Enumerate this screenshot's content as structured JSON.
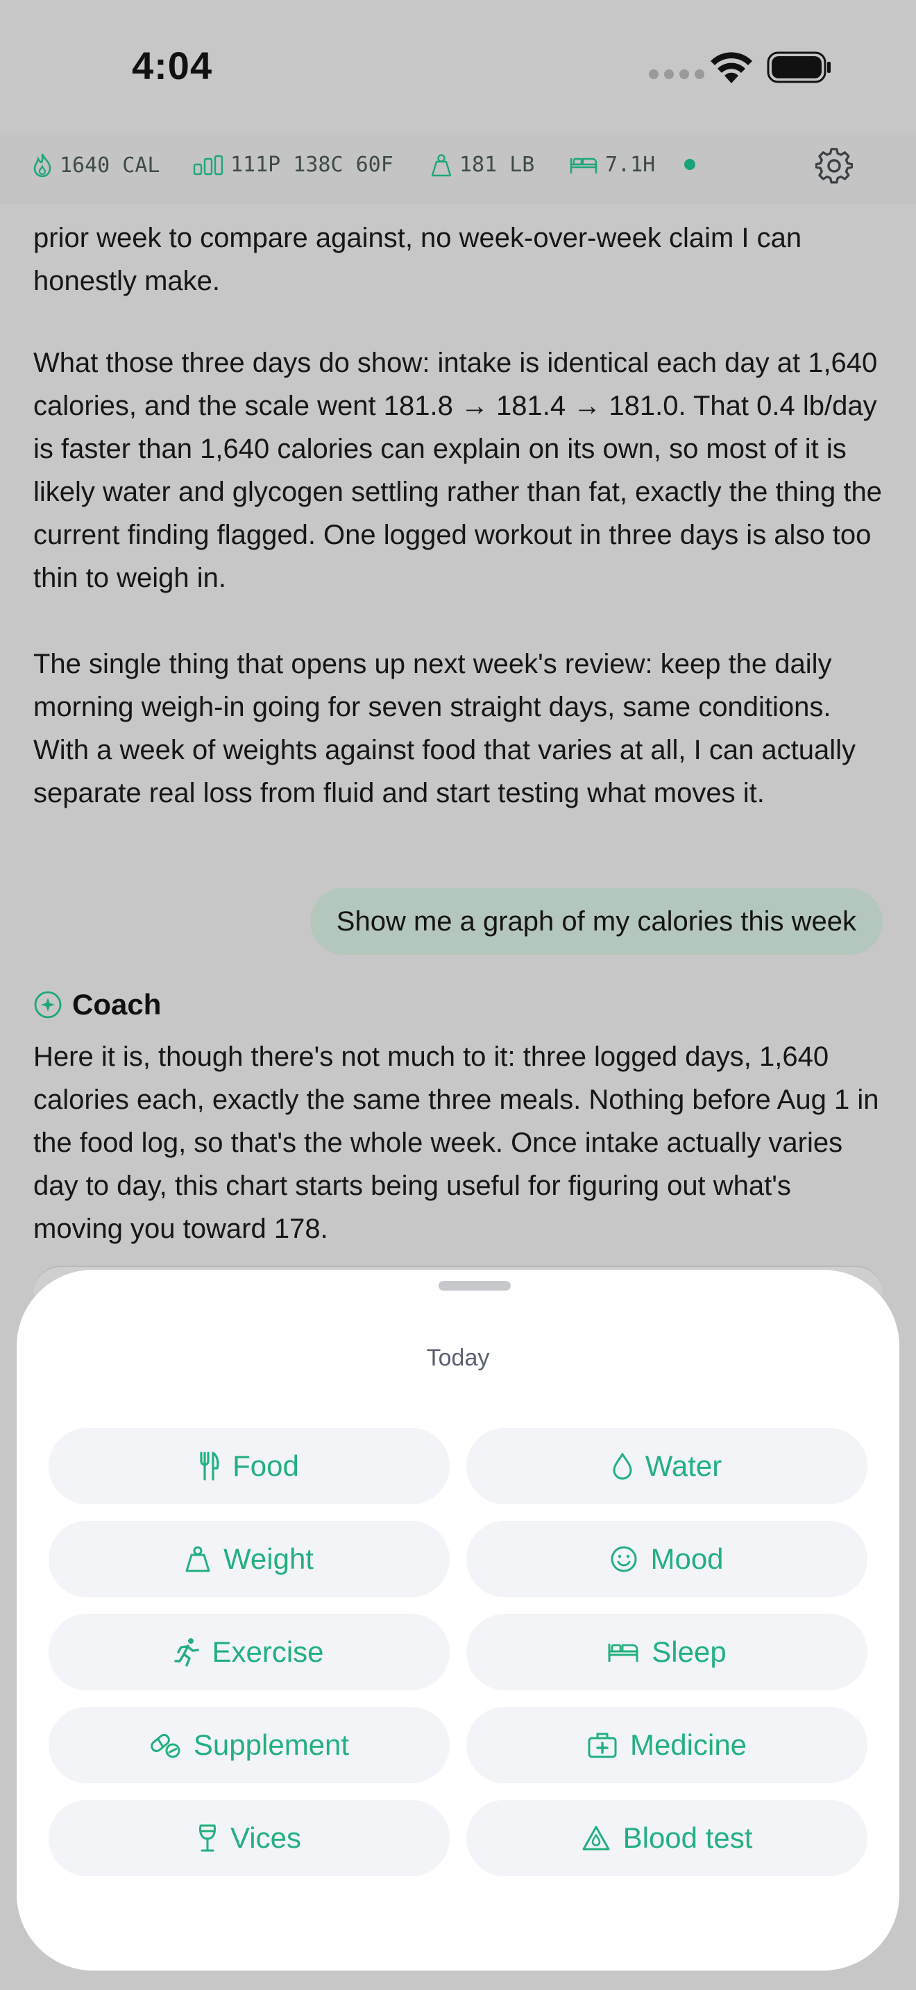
{
  "status_bar": {
    "time": "4:04"
  },
  "metrics": {
    "calories": "1640 CAL",
    "macros": "111P 138C 60F",
    "weight": "181 LB",
    "sleep": "7.1H"
  },
  "chat": {
    "paragraphs": [
      "prior week to compare against, no week-over-week claim I can honestly make.",
      "What those three days do show: intake is identical each day at 1,640 calories, and the scale went 181.8 → 181.4 → 181.0. That 0.4 lb/day is faster than 1,640 calories can explain on its own, so most of it is likely water and glycogen settling rather than fat, exactly the thing the current finding flagged. One logged workout in three days is also too thin to weigh in.",
      "The single thing that opens up next week's review: keep the daily morning weigh-in going for seven straight days, same conditions. With a week of weights against food that varies at all, I can actually separate real loss from fluid and start testing what moves it."
    ],
    "user_message": "Show me a graph of my calories this week",
    "coach_name": "Coach",
    "coach_reply": "Here it is, though there's not much to it: three logged days, 1,640 calories each, exactly the same three meals. Nothing before Aug 1 in the food log, so that's the whole week. Once intake actually varies day to day, this chart starts being useful for figuring out what's moving you toward 178."
  },
  "sheet": {
    "title": "Today",
    "tiles": [
      {
        "label": "Food",
        "icon": "fork-knife-icon"
      },
      {
        "label": "Water",
        "icon": "water-drop-icon"
      },
      {
        "label": "Weight",
        "icon": "scale-weight-icon"
      },
      {
        "label": "Mood",
        "icon": "smiley-face-icon"
      },
      {
        "label": "Exercise",
        "icon": "running-figure-icon"
      },
      {
        "label": "Sleep",
        "icon": "bed-icon"
      },
      {
        "label": "Supplement",
        "icon": "pills-icon"
      },
      {
        "label": "Medicine",
        "icon": "medical-kit-icon"
      },
      {
        "label": "Vices",
        "icon": "wine-glass-icon"
      },
      {
        "label": "Blood test",
        "icon": "blood-drop-triangle-icon"
      }
    ]
  },
  "colors": {
    "accent": "#22b07f",
    "live_dot": "#19a37a",
    "user_bubble": "#b4c7bc",
    "tile_bg": "#f3f4f7"
  }
}
